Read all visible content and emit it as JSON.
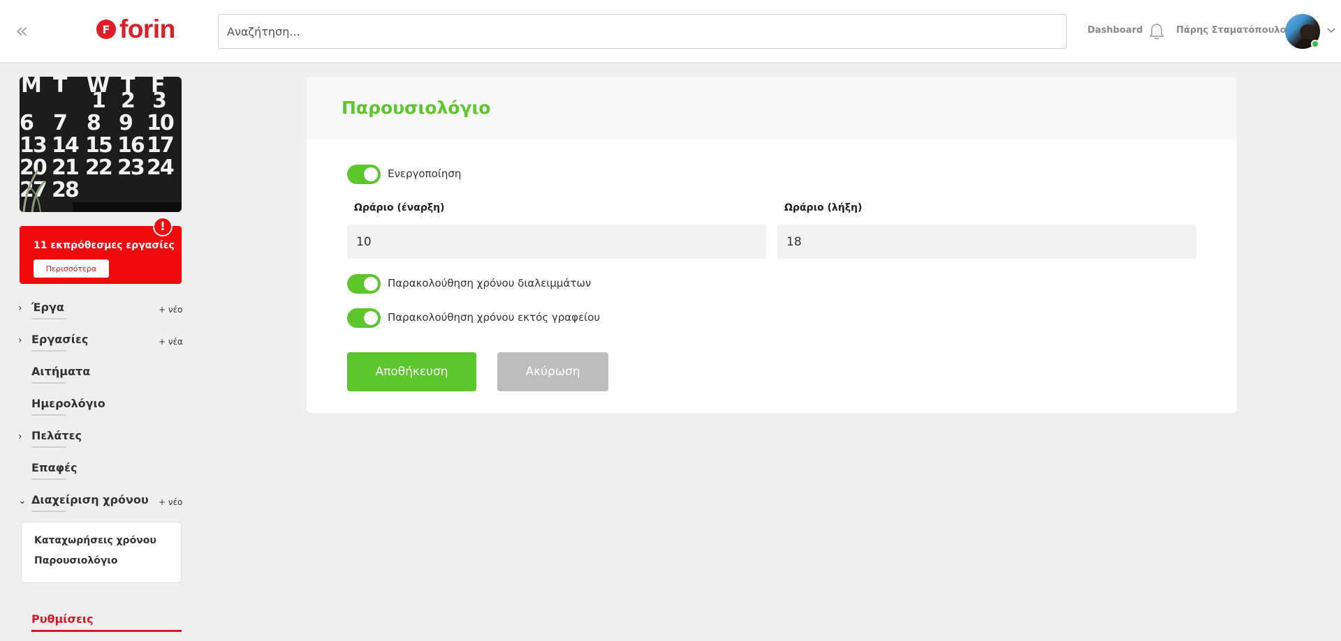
{
  "header": {
    "collapse_icon": "double-chevron-left-icon",
    "logo_text": "forin",
    "logo_mark": "F",
    "search_placeholder": "Αναζήτηση...",
    "dashboard_label": "Dashboard",
    "bell_icon": "bell-icon",
    "user_name": "Πάρης Σταματόπουλος",
    "user_status": "online",
    "caret_icon": "chevron-down-icon"
  },
  "sidebar": {
    "alert": {
      "text": "11 εκπρόθεσμες εργασίες",
      "button": "Περισσότερα",
      "badge": "!"
    },
    "items": [
      {
        "label": "Έργα",
        "caret": "›",
        "new": "+ νέο"
      },
      {
        "label": "Εργασίες",
        "caret": "›",
        "new": "+ νέα"
      },
      {
        "label": "Αιτήματα"
      },
      {
        "label": "Ημερολόγιο"
      },
      {
        "label": "Πελάτες",
        "caret": "›"
      },
      {
        "label": "Επαφές"
      },
      {
        "label": "Διαχείριση χρόνου",
        "caret": "⌄",
        "new": "+ νέο"
      },
      {
        "label": "Ρυθμίσεις"
      }
    ],
    "submenu": [
      "Καταχωρήσεις χρόνου",
      "Παρουσιολόγιο"
    ]
  },
  "main": {
    "title": "Παρουσιολόγιο",
    "toggles": [
      {
        "label": "Ενεργοποίηση",
        "on": true
      },
      {
        "label": "Παρακολούθηση χρόνου διαλειμμάτων",
        "on": true
      },
      {
        "label": "Παρακολούθηση χρόνου εκτός γραφείου",
        "on": true
      }
    ],
    "start": {
      "label": "Ωράριο (έναρξη)",
      "value": "10"
    },
    "end": {
      "label": "Ωράριο (λήξη)",
      "value": "18"
    },
    "save_label": "Αποθήκευση",
    "cancel_label": "Ακύρωση"
  },
  "colors": {
    "accent_green": "#5cc72a",
    "brand_red": "#e01b24",
    "alert_red": "#f20a0a",
    "active_nav": "#d4192a"
  }
}
